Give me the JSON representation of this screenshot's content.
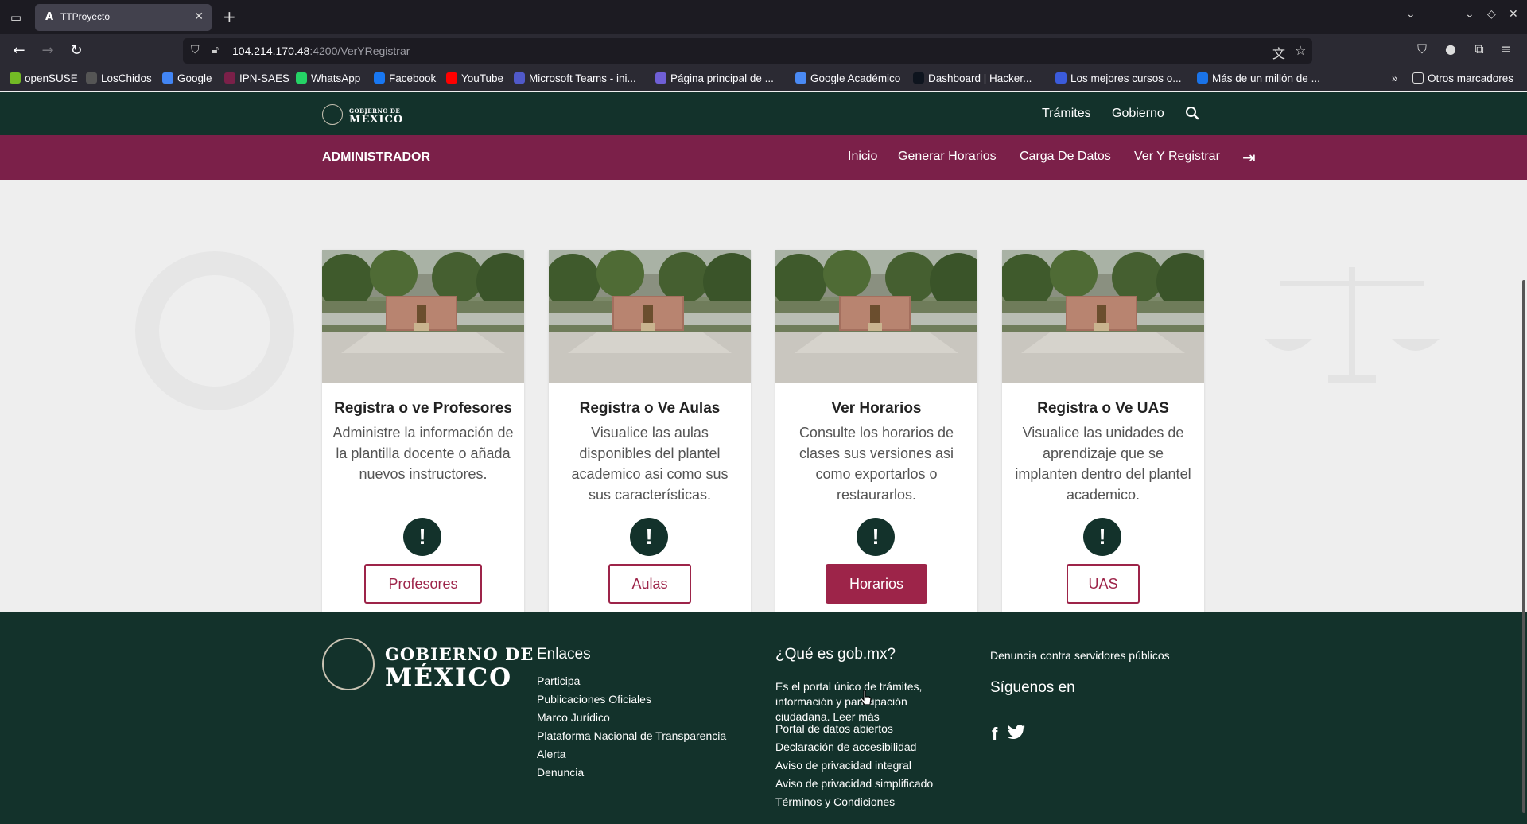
{
  "browser": {
    "tab_title": "TTProyecto",
    "tab_favicon": "A",
    "url_host": "104.214.170.48",
    "url_path": ":4200/VerYRegistrar"
  },
  "bookmarks": [
    {
      "label": "openSUSE",
      "icon": "opensuse-icon",
      "color": "#73ba25"
    },
    {
      "label": "LosChidos",
      "icon": "github-icon",
      "color": "#555555"
    },
    {
      "label": "Google",
      "icon": "google-icon",
      "color": "#4285f4"
    },
    {
      "label": "IPN-SAES",
      "icon": "ipn-icon",
      "color": "#7b2049"
    },
    {
      "label": "WhatsApp",
      "icon": "whatsapp-icon",
      "color": "#25d366"
    },
    {
      "label": "Facebook",
      "icon": "facebook-icon",
      "color": "#1877f2"
    },
    {
      "label": "YouTube",
      "icon": "youtube-icon",
      "color": "#ff0000"
    },
    {
      "label": "Microsoft Teams - ini...",
      "icon": "teams-icon",
      "color": "#5059c9"
    },
    {
      "label": "Página principal de ...",
      "icon": "page-icon",
      "color": "#6f5fd6"
    },
    {
      "label": "Google Académico",
      "icon": "scholar-icon",
      "color": "#4a8af4"
    },
    {
      "label": "Dashboard | Hacker...",
      "icon": "hackerrank-icon",
      "color": "#0e141e"
    },
    {
      "label": "Los mejores cursos o...",
      "icon": "courses-icon",
      "color": "#3b5bdb"
    },
    {
      "label": "Más de un millón de ...",
      "icon": "million-icon",
      "color": "#1a73e8"
    }
  ],
  "other_bookmarks": "Otros marcadores",
  "gob": {
    "logo_small": "GOBIERNO DE",
    "logo_big": "MÉXICO",
    "links": [
      "Trámites",
      "Gobierno"
    ]
  },
  "admin": {
    "title": "ADMINISTRADOR",
    "nav": [
      "Inicio",
      "Generar Horarios",
      "Carga De Datos",
      "Ver Y Registrar"
    ]
  },
  "cards": [
    {
      "title": "Registra o ve Profesores",
      "description": "Administre la información de la plantilla docente o añada nuevos instructores.",
      "button": "Profesores"
    },
    {
      "title": "Registra o Ve Aulas",
      "description": "Visualice las aulas disponibles del plantel academico asi como sus sus características.",
      "button": "Aulas"
    },
    {
      "title": "Ver Horarios",
      "description": "Consulte los horarios de clases sus versiones asi como exportarlos o restaurarlos.",
      "button": "Horarios"
    },
    {
      "title": "Registra o Ve UAS",
      "description": "Visualice las unidades de aprendizaje que se implanten dentro del plantel academico.",
      "button": "UAS"
    }
  ],
  "footer": {
    "logo_small": "GOBIERNO DE",
    "logo_big": "MÉXICO",
    "enlaces_title": "Enlaces",
    "enlaces": [
      "Participa",
      "Publicaciones Oficiales",
      "Marco Jurídico",
      "Plataforma Nacional de Transparencia",
      "Alerta",
      "Denuncia"
    ],
    "que_es_title": "¿Qué es gob.mx?",
    "que_es_text": "Es el portal único de trámites, información y participación ciudadana. Leer más",
    "que_es_links": [
      "Portal de datos abiertos",
      "Declaración de accesibilidad",
      "Aviso de privacidad integral",
      "Aviso de privacidad simplificado",
      "Términos y Condiciones"
    ],
    "denuncia": "Denuncia contra servidores públicos",
    "siguenos": "Síguenos en"
  }
}
